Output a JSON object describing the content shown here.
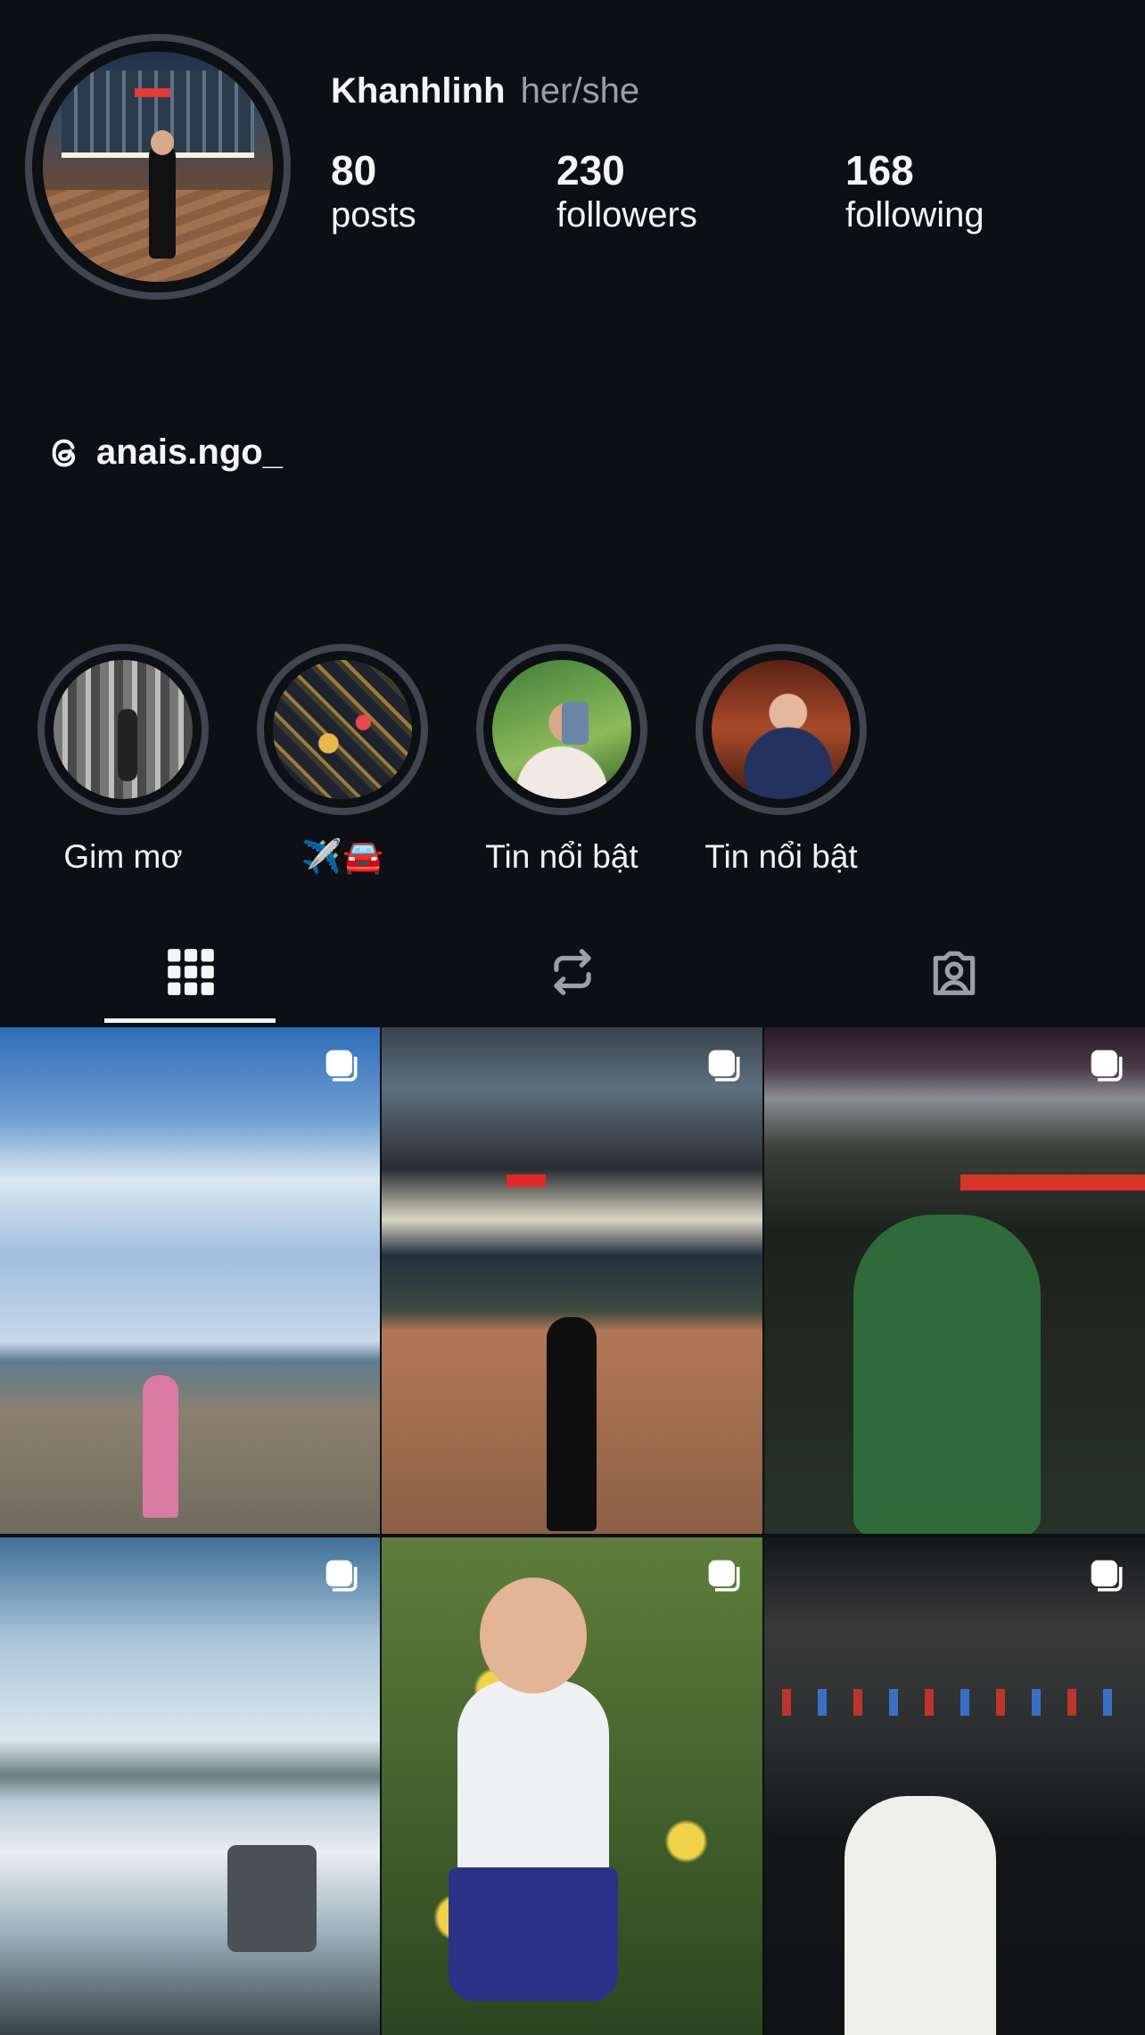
{
  "profile": {
    "name": "Khanhlinh",
    "pronouns": "her/she",
    "stats": [
      {
        "count": "80",
        "label": "posts"
      },
      {
        "count": "230",
        "label": "followers"
      },
      {
        "count": "168",
        "label": "following"
      }
    ],
    "threads_handle": "anais.ngo_"
  },
  "highlights": [
    {
      "label": "Gim mơ"
    },
    {
      "label": "✈️🚘"
    },
    {
      "label": "Tin nổi bật"
    },
    {
      "label": "Tin nổi bật"
    }
  ],
  "tabs": [
    {
      "icon": "grid-icon",
      "active": true
    },
    {
      "icon": "reposts-icon",
      "active": false
    },
    {
      "icon": "tagged-icon",
      "active": false
    }
  ],
  "colors": {
    "background": "#0c0f14",
    "ring": "#3f4650",
    "muted_text": "#9aa0a8",
    "text": "#f5f5f5"
  }
}
